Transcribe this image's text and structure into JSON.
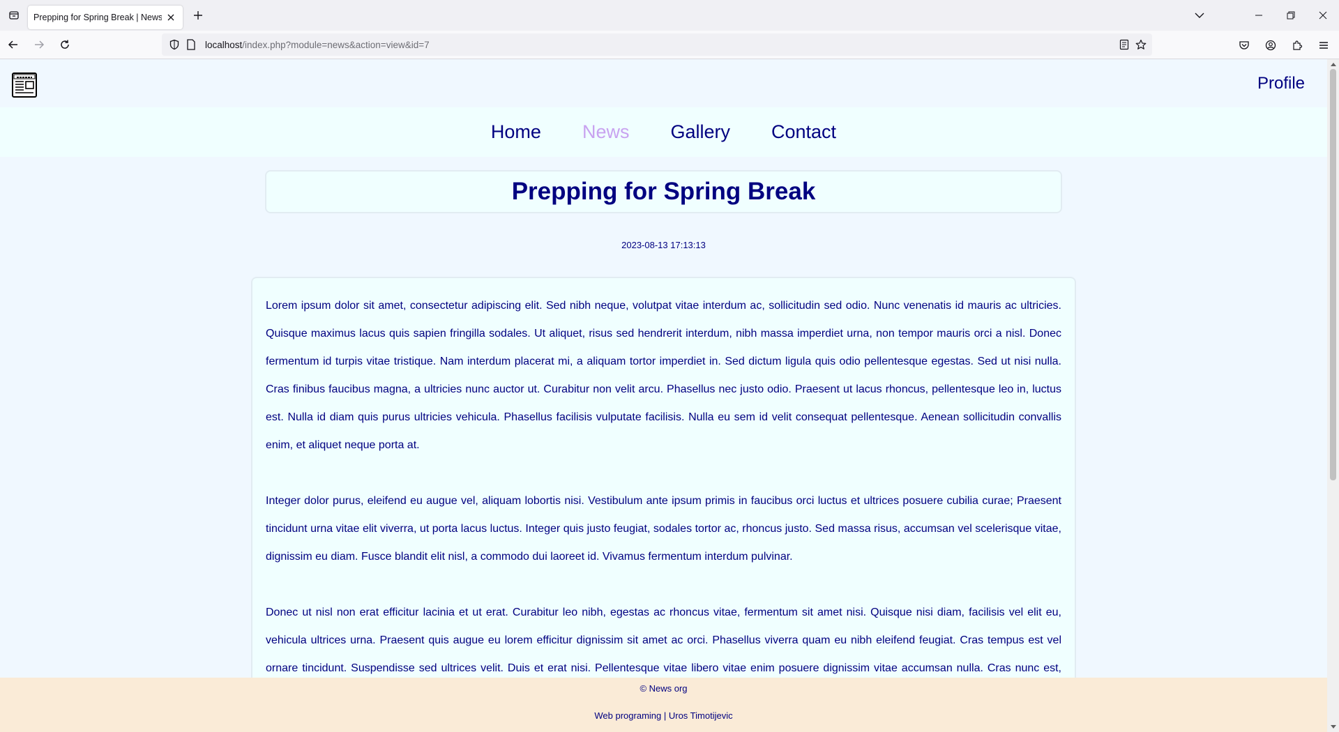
{
  "browser": {
    "tab_title": "Prepping for Spring Break | News org",
    "url_host": "localhost",
    "url_path": "/index.php?module=news&action=view&id=7"
  },
  "site": {
    "profile_label": "Profile",
    "nav": [
      {
        "label": "Home",
        "active": false
      },
      {
        "label": "News",
        "active": true
      },
      {
        "label": "Gallery",
        "active": false
      },
      {
        "label": "Contact",
        "active": false
      }
    ]
  },
  "article": {
    "title": "Prepping for Spring Break",
    "date": "2023-08-13 17:13:13",
    "paragraphs": [
      "Lorem ipsum dolor sit amet, consectetur adipiscing elit. Sed nibh neque, volutpat vitae interdum ac, sollicitudin sed odio. Nunc venenatis id mauris ac ultricies. Quisque maximus lacus quis sapien fringilla sodales. Ut aliquet, risus sed hendrerit interdum, nibh massa imperdiet urna, non tempor mauris orci a nisl. Donec fermentum id turpis vitae tristique. Nam interdum placerat mi, a aliquam tortor imperdiet in. Sed dictum ligula quis odio pellentesque egestas. Sed ut nisi nulla. Cras finibus faucibus magna, a ultricies nunc auctor ut. Curabitur non velit arcu. Phasellus nec justo odio. Praesent ut lacus rhoncus, pellentesque leo in, luctus est. Nulla id diam quis purus ultricies vehicula. Phasellus facilisis vulputate facilisis. Nulla eu sem id velit consequat pellentesque. Aenean sollicitudin convallis enim, et aliquet neque porta at.",
      "Integer dolor purus, eleifend eu augue vel, aliquam lobortis nisi. Vestibulum ante ipsum primis in faucibus orci luctus et ultrices posuere cubilia curae; Praesent tincidunt urna vitae elit viverra, ut porta lacus luctus. Integer quis justo feugiat, sodales tortor ac, rhoncus justo. Sed massa risus, accumsan vel scelerisque vitae, dignissim eu diam. Fusce blandit elit nisl, a commodo dui laoreet id. Vivamus fermentum interdum pulvinar.",
      "Donec ut nisl non erat efficitur lacinia et ut erat. Curabitur leo nibh, egestas ac rhoncus vitae, fermentum sit amet nisi. Quisque nisi diam, facilisis vel elit eu, vehicula ultrices urna. Praesent quis augue eu lorem efficitur dignissim sit amet ac orci. Phasellus viverra quam eu nibh eleifend feugiat. Cras tempus est vel ornare tincidunt. Suspendisse sed ultrices velit. Duis et erat nisi. Pellentesque vitae libero vitae enim posuere dignissim vitae accumsan nulla. Cras nunc est, laoreet sed nibh non,"
    ]
  },
  "footer": {
    "copyright": "© News org",
    "credit": "Web programing | Uros Timotijevic"
  },
  "colors": {
    "text_primary": "#000080",
    "nav_active": "#c8a2f0",
    "footer_bg": "#faebd7",
    "page_bg": "#f0f8ff"
  },
  "icons": [
    "tab-list-icon",
    "close-icon",
    "plus-icon",
    "chevron-down-icon",
    "minimize-icon",
    "restore-icon",
    "back-arrow-icon",
    "forward-arrow-icon",
    "reload-icon",
    "shield-icon",
    "page-icon",
    "reader-mode-icon",
    "star-icon",
    "pocket-icon",
    "account-icon",
    "extensions-icon",
    "menu-icon",
    "newspaper-icon"
  ]
}
